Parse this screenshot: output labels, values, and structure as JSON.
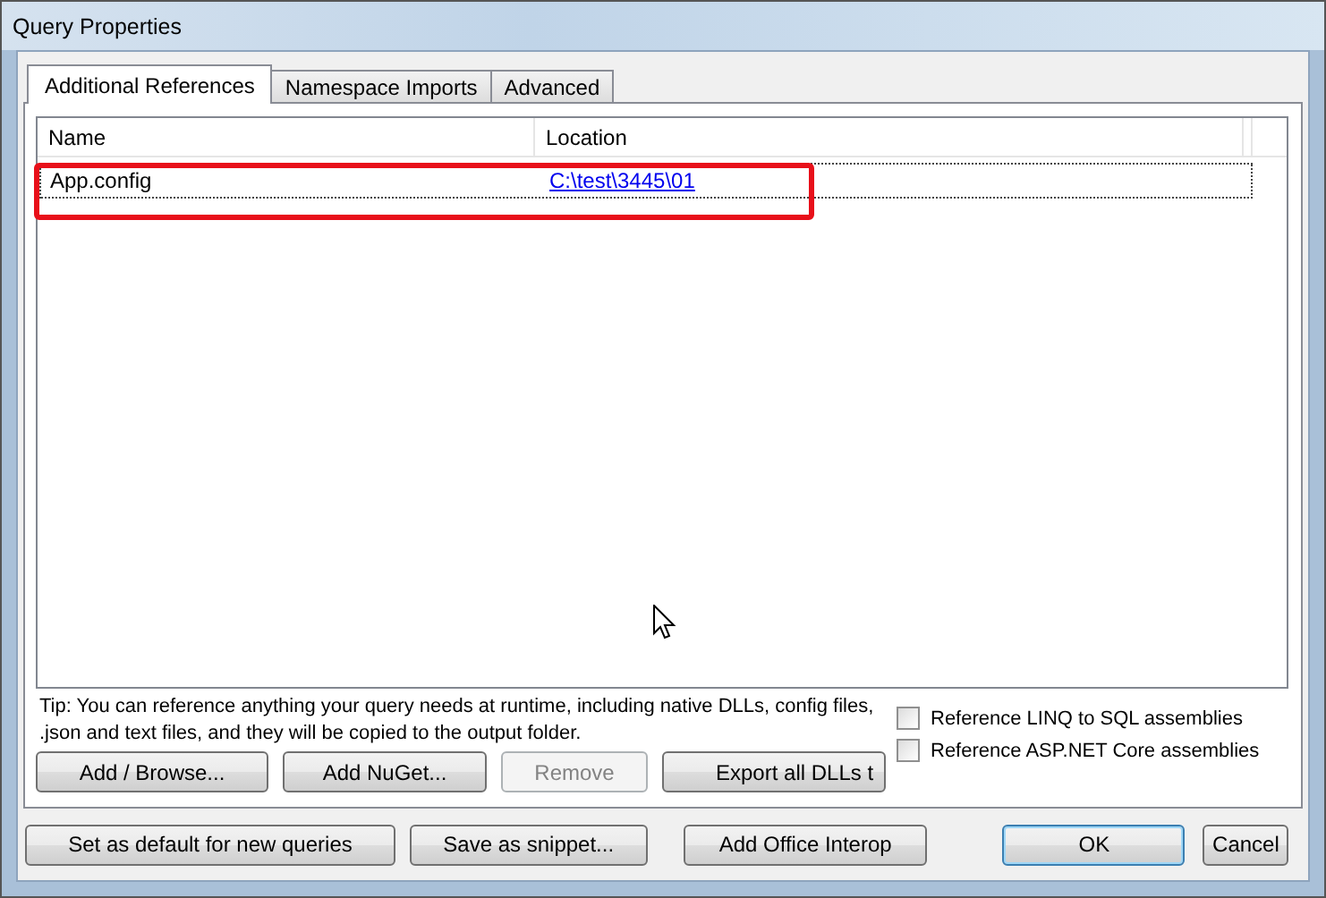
{
  "window": {
    "title": "Query Properties"
  },
  "tabs": [
    {
      "label": "Additional References",
      "selected": true
    },
    {
      "label": "Namespace Imports",
      "selected": false
    },
    {
      "label": "Advanced",
      "selected": false
    }
  ],
  "table": {
    "columns": [
      "Name",
      "Location"
    ],
    "rows": [
      {
        "name": "App.config",
        "location": "C:\\test\\3445\\01",
        "selected": true,
        "highlighted": true
      }
    ]
  },
  "tip": "Tip: You can reference anything your query needs at runtime, including native DLLs, config files, .json and text files, and they will be copied to the output folder.",
  "panel_buttons": [
    {
      "label": "Add / Browse...",
      "disabled": false
    },
    {
      "label": "Add NuGet...",
      "disabled": false
    },
    {
      "label": "Remove",
      "disabled": true
    },
    {
      "label": "Export all DLLs t",
      "disabled": false
    }
  ],
  "checkboxes": [
    {
      "label": "Reference LINQ to SQL assemblies",
      "checked": false
    },
    {
      "label": "Reference ASP.NET Core assemblies",
      "checked": false
    }
  ],
  "buttons": [
    {
      "label": "Set as default for new queries",
      "default": false
    },
    {
      "label": "Save as snippet...",
      "default": false
    },
    {
      "label": "Add Office Interop",
      "default": false
    },
    {
      "label": "OK",
      "default": true
    },
    {
      "label": "Cancel",
      "default": false
    }
  ]
}
